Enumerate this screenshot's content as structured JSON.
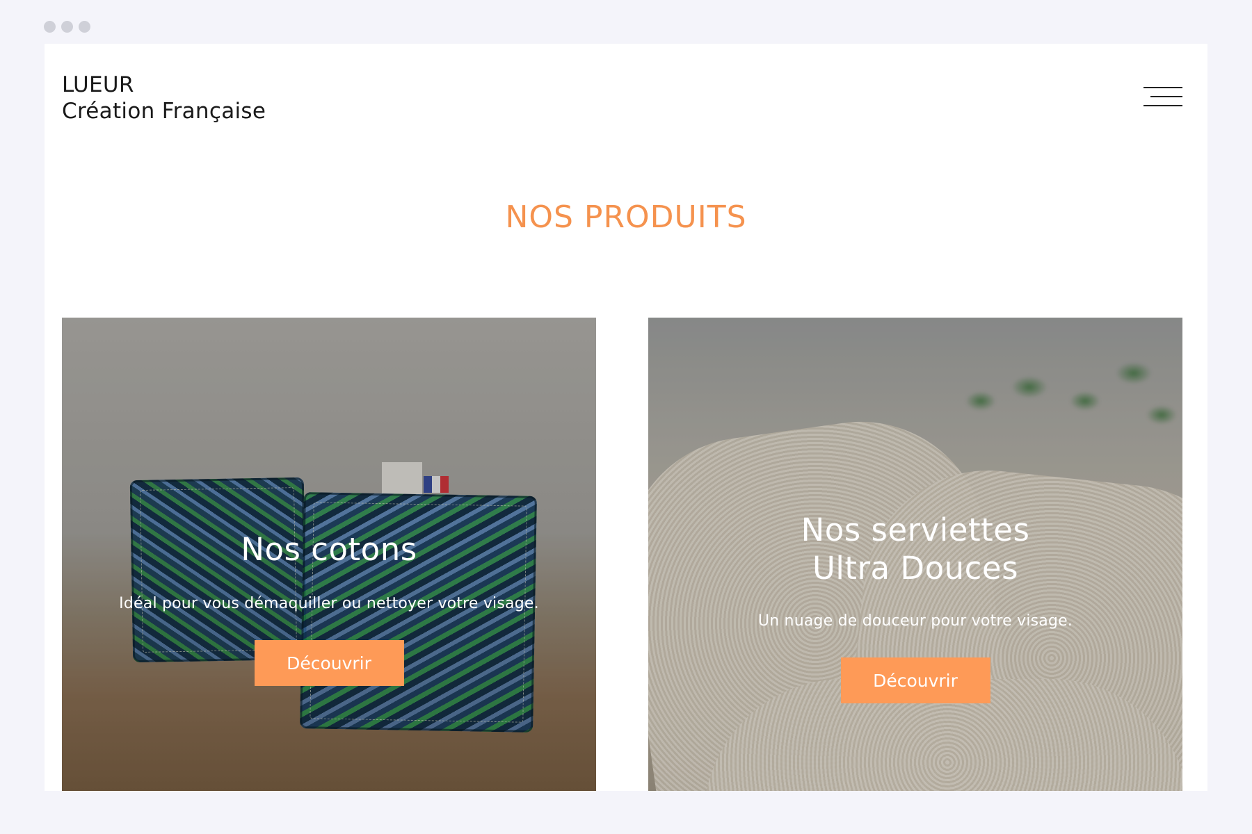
{
  "brand": {
    "name": "LUEUR",
    "tagline": "Création Française"
  },
  "menu": {
    "icon": "hamburger-menu-icon"
  },
  "section": {
    "title": "NOS PRODUITS"
  },
  "products": [
    {
      "title_line1": "Nos cotons",
      "title_line2": "",
      "description": "Idéal pour vous démaquiller ou nettoyer votre visage.",
      "cta": "Découvrir"
    },
    {
      "title_line1": "Nos serviettes",
      "title_line2": "Ultra Douces",
      "description": "Un nuage de douceur pour votre visage.",
      "cta": "Découvrir"
    }
  ],
  "colors": {
    "accent": "#fe9a57",
    "title": "#f5924e",
    "background": "#f4f4fa"
  }
}
